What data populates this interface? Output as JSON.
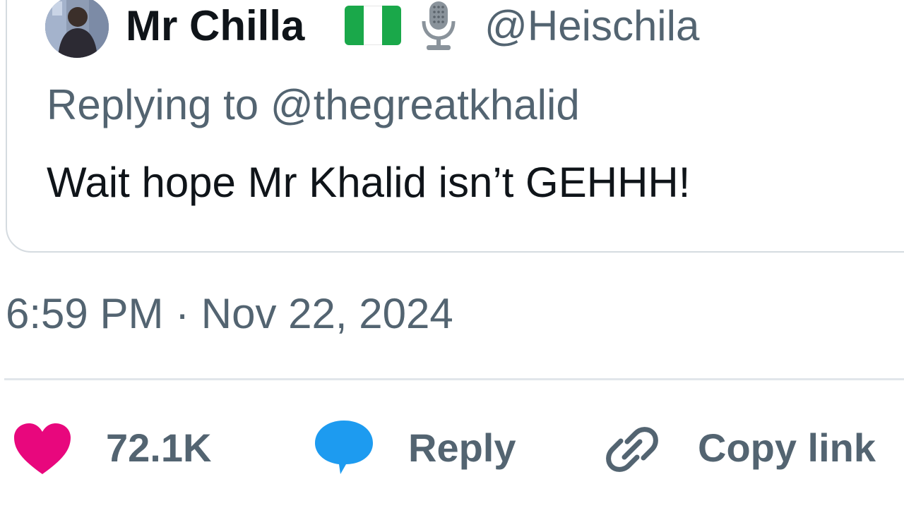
{
  "quoted_tweet": {
    "display_name": "Mr Chilla",
    "emojis": [
      "nigeria-flag-emoji",
      "microphone-emoji"
    ],
    "handle": "@Heischila",
    "replying_to": "Replying to @thegreatkhalid",
    "text": "Wait hope Mr Khalid isn’t GEHHH!"
  },
  "timestamp": "6:59 PM · Nov 22, 2024",
  "actions": {
    "like": {
      "icon": "heart-icon",
      "label": "72.1K",
      "color": "#e8077d"
    },
    "reply": {
      "icon": "speech-bubble-icon",
      "label": "Reply",
      "color": "#1d9bf0"
    },
    "copy_link": {
      "icon": "link-icon",
      "label": "Copy link",
      "color": "#536471"
    }
  },
  "colors": {
    "primary_text": "#0f1419",
    "secondary_text": "#536471",
    "border": "#d5dbe0",
    "flag_green": "#1aa84a"
  }
}
